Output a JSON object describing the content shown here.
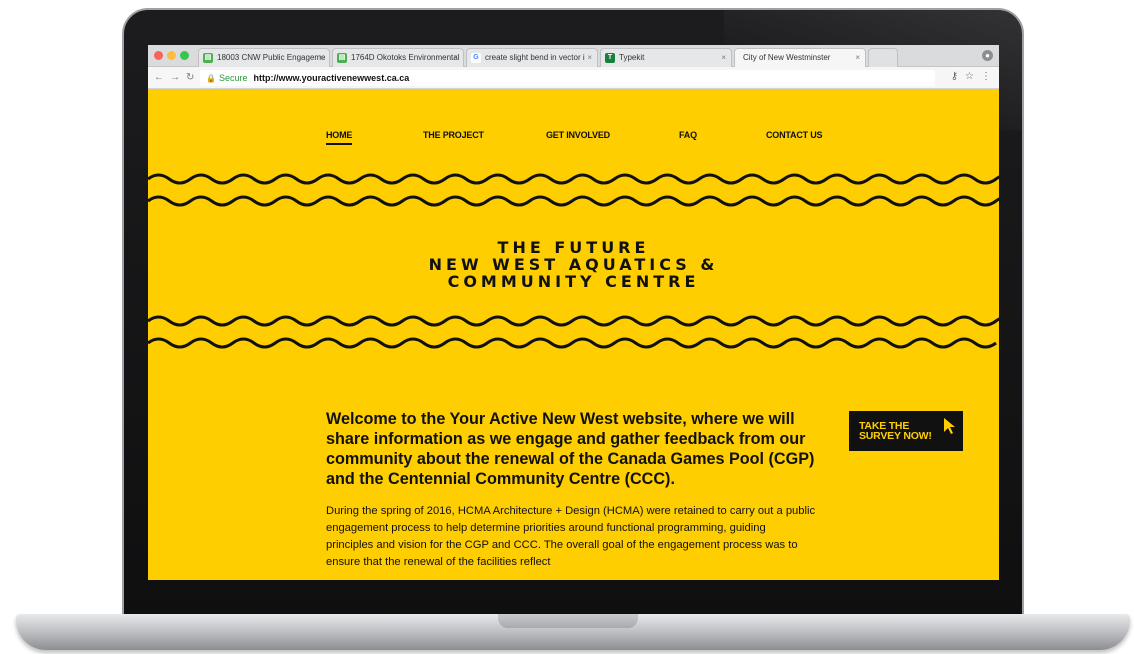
{
  "browser": {
    "tabs": [
      {
        "title": "18003 CNW Public Engageme",
        "favicon": "document-icon",
        "favicon_color": "#4caf50"
      },
      {
        "title": "1764D Okotoks Environmental",
        "favicon": "document-icon",
        "favicon_color": "#4caf50"
      },
      {
        "title": "create slight bend in vector i",
        "favicon": "google-icon",
        "favicon_color": "#4285f4"
      },
      {
        "title": "Typekit",
        "favicon": "typekit-icon",
        "favicon_color": "#1a7f3c"
      },
      {
        "title": "City of New Westminster",
        "favicon": "",
        "favicon_color": ""
      }
    ],
    "secure_label": "Secure",
    "url": "http://www.youractivenewwest.ca.ca"
  },
  "site": {
    "nav": [
      "HOME",
      "THE PROJECT",
      "GET INVOLVED",
      "FAQ",
      "CONTACT US"
    ],
    "active_nav": "HOME",
    "hero": {
      "line1": "THE FUTURE",
      "line2": "NEW WEST AQUATICS &",
      "line3": "COMMUNITY CENTRE"
    },
    "welcome": "Welcome to the Your Active New West website, where we will share information as we engage and gather feedback from our community about the renewal of the Canada Games Pool (CGP) and the Centennial Community Centre (CCC).",
    "body": "During the spring of 2016, HCMA Architecture + Design (HCMA) were retained to carry out a public engagement process to help determine priorities around functional programming, guiding principles and vision for the CGP and CCC. The overall goal of the engagement process was to ensure that the renewal of the facilities reflect",
    "survey_button": {
      "line1": "TAKE THE",
      "line2": "SURVEY NOW!"
    }
  },
  "colors": {
    "brand_yellow": "#ffce00",
    "ink": "#111111"
  }
}
